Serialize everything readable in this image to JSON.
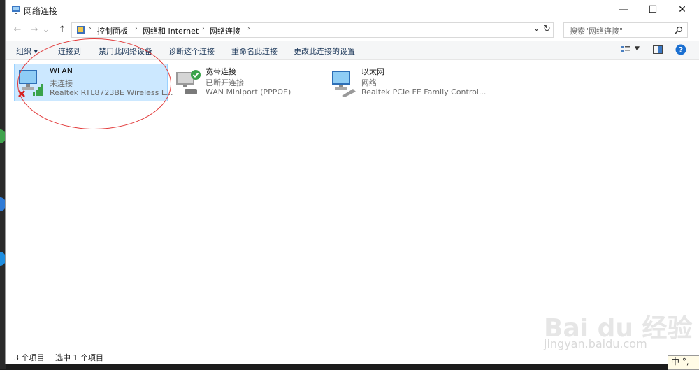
{
  "window": {
    "title": "网络连接",
    "minimize": "—",
    "maximize": "☐",
    "close": "✕"
  },
  "nav": {
    "back": "←",
    "forward": "→",
    "recent": "⌄",
    "up": "↑",
    "refresh": "↻",
    "dropdown": "⌄"
  },
  "breadcrumb": {
    "items": [
      "控制面板",
      "网络和 Internet",
      "网络连接"
    ],
    "sep": "›"
  },
  "search": {
    "placeholder": "搜索\"网络连接\""
  },
  "commands": {
    "organize": "组织 ▾",
    "connect": "连接到",
    "disable": "禁用此网络设备",
    "diagnose": "诊断这个连接",
    "rename": "重命名此连接",
    "settings": "更改此连接的设置"
  },
  "connections": [
    {
      "name": "WLAN",
      "status": "未连接",
      "device": "Realtek RTL8723BE Wireless L..."
    },
    {
      "name": "宽带连接",
      "status": "已断开连接",
      "device": "WAN Miniport (PPPOE)"
    },
    {
      "name": "以太网",
      "status": "网络",
      "device": "Realtek PCIe FE Family Control..."
    }
  ],
  "statusbar": {
    "count": "3 个项目",
    "selected": "选中 1 个项目"
  },
  "watermark": {
    "brand": "Bai du 经验",
    "url": "jingyan.baidu.com"
  },
  "ime": "中 °,",
  "colors": {
    "selection": "#cce8ff",
    "annotation": "#e23a3a",
    "link": "#1e395b"
  }
}
